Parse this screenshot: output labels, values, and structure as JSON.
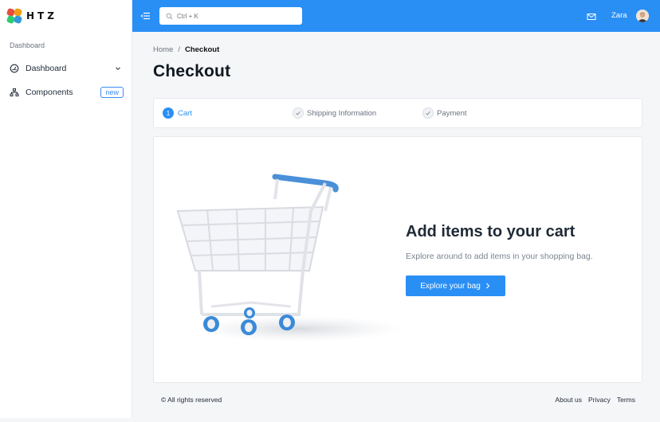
{
  "brand": {
    "name": "HTZ",
    "logo_colors": [
      "#2ecc71",
      "#f39c12",
      "#e74c3c",
      "#3498db"
    ]
  },
  "sidebar": {
    "section_label": "Dashboard",
    "items": [
      {
        "label": "Dashboard",
        "icon": "gauge-icon",
        "has_submenu": true
      },
      {
        "label": "Components",
        "icon": "sitemap-icon",
        "badge": "new"
      }
    ]
  },
  "header": {
    "search_placeholder": "Ctrl + K",
    "user_name": "Zara",
    "accent": "#2a8ff5"
  },
  "breadcrumb": {
    "home": "Home",
    "separator": "/",
    "current": "Checkout"
  },
  "page_title": "Checkout",
  "steps": [
    {
      "label": "Cart",
      "number": "1",
      "state": "active"
    },
    {
      "label": "Shipping Information",
      "state": "pending"
    },
    {
      "label": "Payment",
      "state": "pending"
    }
  ],
  "empty_cart": {
    "title": "Add items to your cart",
    "subtitle": "Explore around to add items in your shopping bag.",
    "button_label": "Explore your bag"
  },
  "footer": {
    "copyright": "© All rights reserved",
    "links": [
      "About us",
      "Privacy",
      "Terms"
    ]
  }
}
